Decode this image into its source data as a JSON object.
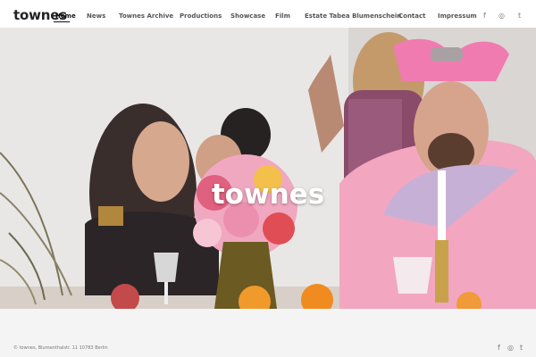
{
  "site": {
    "logo": "townes"
  },
  "nav": {
    "items": [
      {
        "label": "Home"
      },
      {
        "label": "News"
      },
      {
        "label": "Townes Archive"
      },
      {
        "label": "Productions"
      },
      {
        "label": "Showcase"
      },
      {
        "label": "Film"
      },
      {
        "label": "Estate Tabea Blumenschein"
      },
      {
        "label": "Contact"
      },
      {
        "label": "Impressum"
      }
    ],
    "active": "Home"
  },
  "social": {
    "facebook": "f",
    "instagram": "◎",
    "tumblr": "t"
  },
  "hero": {
    "title": "townes"
  },
  "footer": {
    "text": "© townes, Blumenthalstr. 11 10783 Berlin"
  },
  "colors": {
    "header_bg": "#ffffff",
    "page_bg": "#f4f4f4",
    "pink": "#f2a6c0",
    "text": "#222222"
  }
}
